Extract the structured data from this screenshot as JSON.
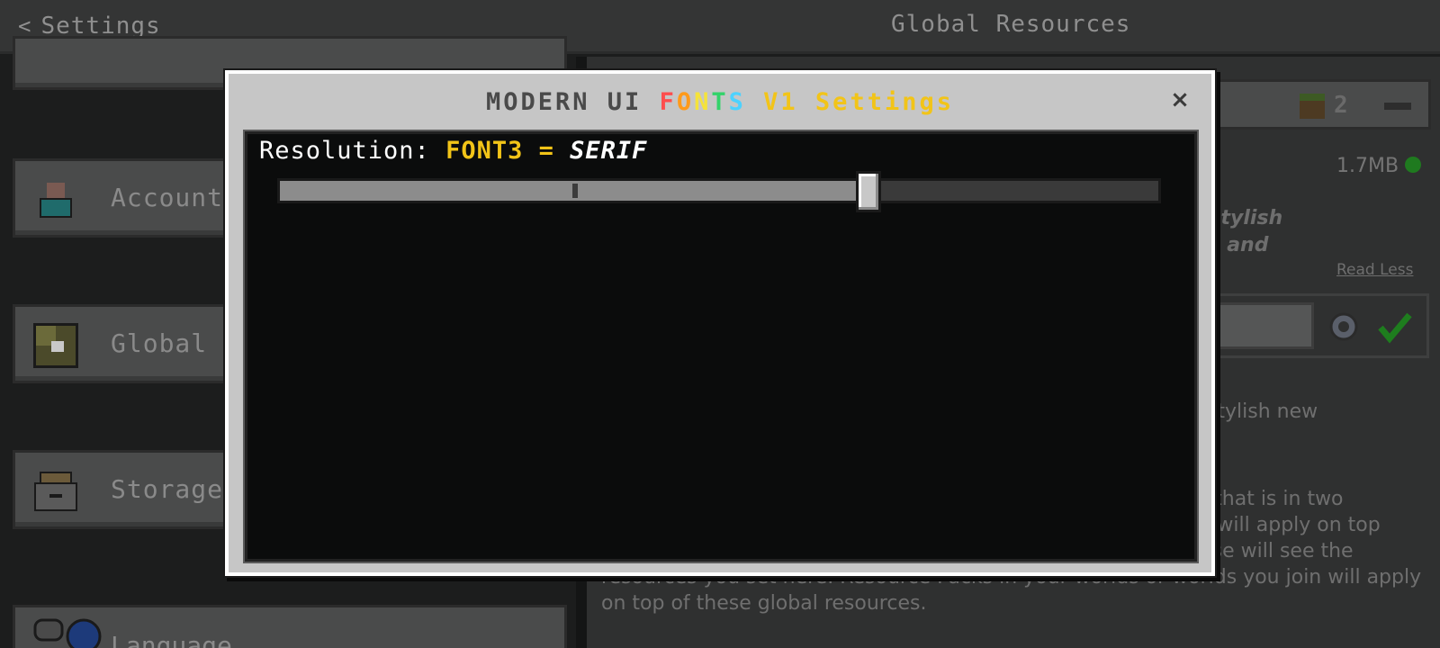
{
  "header": {
    "back_label": "Settings",
    "page_title": "Global Resources"
  },
  "sidebar": {
    "items": [
      {
        "label": "Account",
        "icon": "account-icon"
      },
      {
        "label": "Global Resources",
        "icon": "global-resources-icon"
      },
      {
        "label": "Storage",
        "icon": "storage-icon"
      },
      {
        "label": "Language",
        "icon": "language-icon"
      }
    ]
  },
  "right_panel": {
    "pack_count": "2",
    "pack_size": "1.7MB",
    "desc_italic_line1": "d stylish",
    "desc_italic_line2": "les and",
    "read_less": "Read Less",
    "body_line1": "h stylish new",
    "body_line2": "et that is in two",
    "body_line3": "ds will apply on top",
    "body_line4": " else will see the",
    "body_line5": "resources you set here. Resource Packs in your worlds or worlds you join will apply",
    "body_line6": "on top of these global resources."
  },
  "modal": {
    "title_part1": "MODERN UI ",
    "title_rainbow": [
      "F",
      "O",
      "N",
      "T",
      "S"
    ],
    "title_rainbow_colors": [
      "#ff4d4d",
      "#ff9a1a",
      "#f5e33a",
      "#33d36a",
      "#4dd2ff"
    ],
    "title_part2": " V1",
    "title_part3": " Settings",
    "close_label": "×",
    "resolution_label": "Resolution: ",
    "resolution_value": "FONT3",
    "resolution_eq": " = ",
    "resolution_style": "SERIF",
    "slider_value_fraction": 0.667,
    "slider_tick_fraction": 0.333
  },
  "colors": {
    "accent_yellow": "#f2c418",
    "title_gray": "#4a4a4a",
    "check_green": "#1e7d1e"
  }
}
